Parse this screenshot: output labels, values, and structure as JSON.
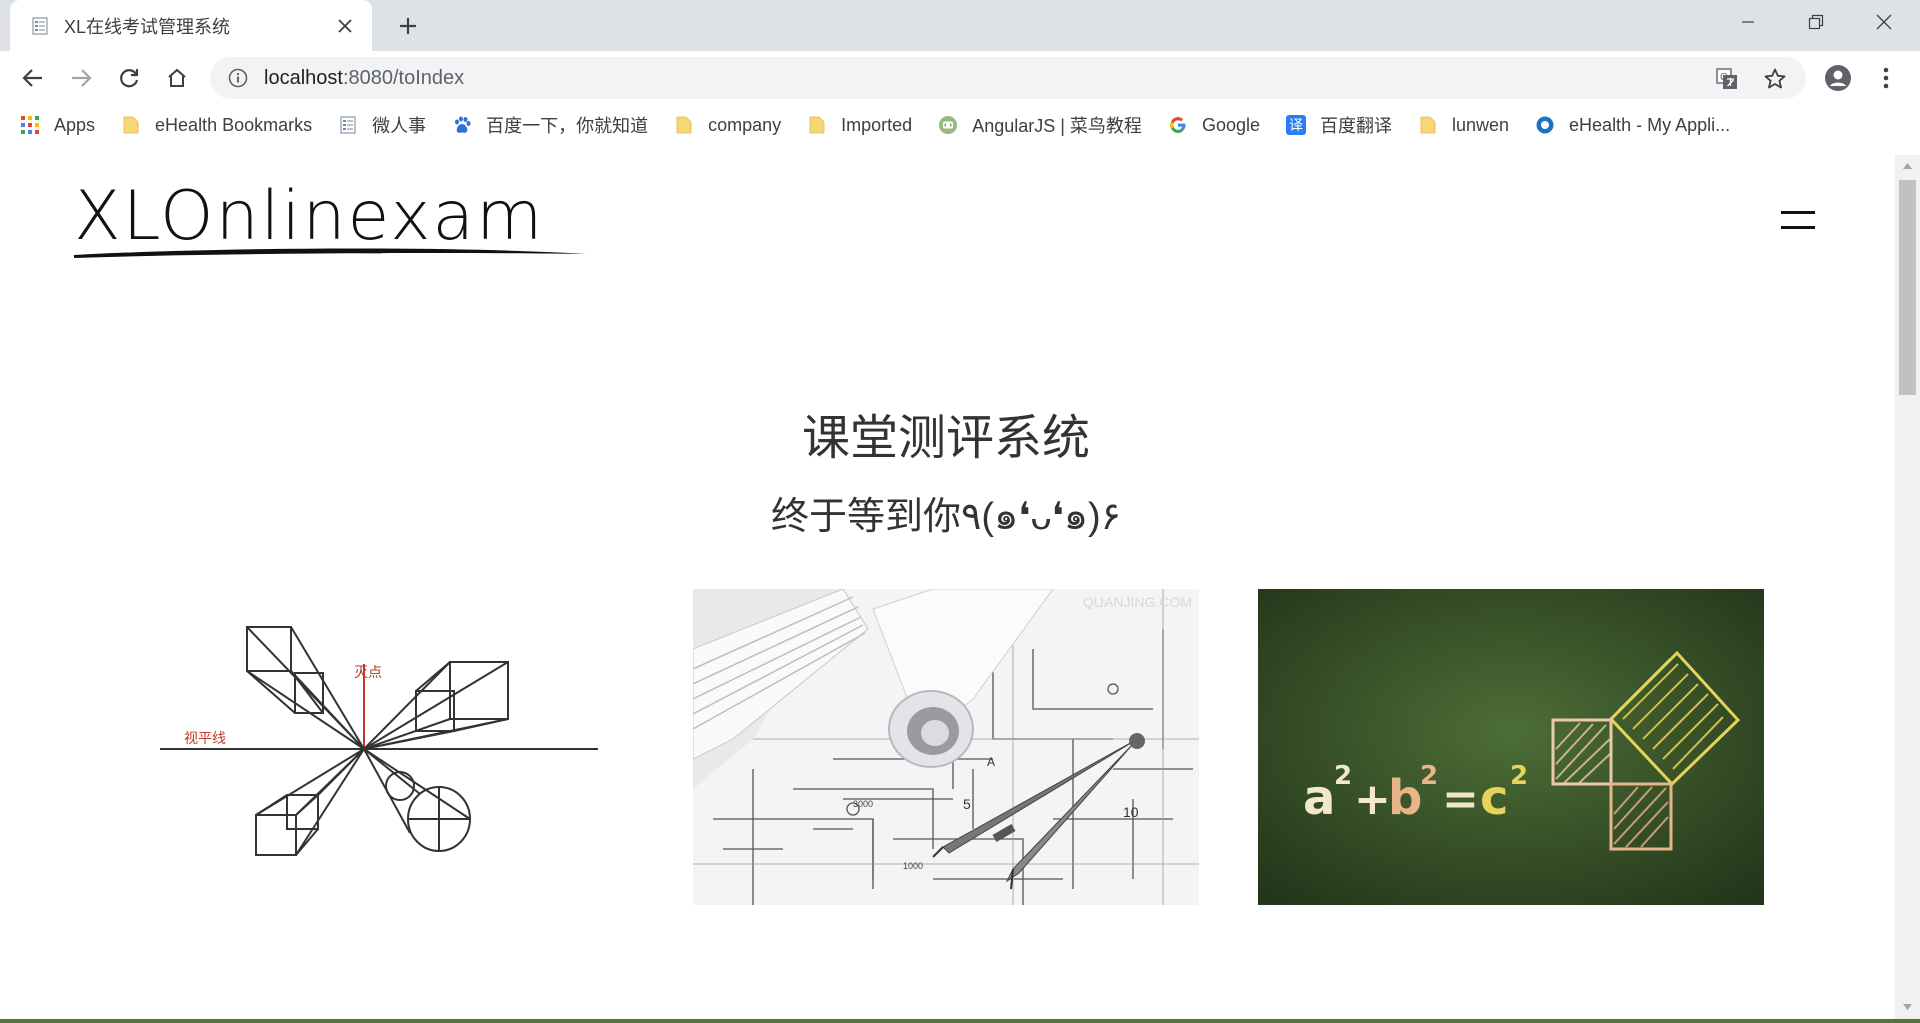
{
  "browser": {
    "tab_title": "XL在线考试管理系统",
    "url_host": "localhost",
    "url_rest": ":8080/toIndex",
    "bookmarks": [
      {
        "label": "Apps",
        "icon": "apps-grid-icon"
      },
      {
        "label": "eHealth Bookmarks",
        "icon": "folder-icon"
      },
      {
        "label": "微人事",
        "icon": "page-icon"
      },
      {
        "label": "百度一下，你就知道",
        "icon": "baidu-paw-icon"
      },
      {
        "label": "company",
        "icon": "folder-icon"
      },
      {
        "label": "Imported",
        "icon": "folder-icon"
      },
      {
        "label": "AngularJS | 菜鸟教程",
        "icon": "runoob-icon"
      },
      {
        "label": "Google",
        "icon": "google-g-icon"
      },
      {
        "label": "百度翻译",
        "icon": "baidu-translate-icon"
      },
      {
        "label": "lunwen",
        "icon": "folder-icon"
      },
      {
        "label": "eHealth - My Appli...",
        "icon": "ehealth-ring-icon"
      }
    ],
    "translate_badge": "G",
    "baidu_translate_glyph": "译"
  },
  "page": {
    "logo_text": "XLOnlinexam",
    "title": "课堂测评系统",
    "subtitle": "终于等到你٩(๑❛ᴗ❛๑)۶",
    "cards": [
      {
        "name": "perspective-drawing",
        "labels": [
          "灭点",
          "视平线"
        ]
      },
      {
        "name": "blueprint-compass",
        "labels": [
          "QUANJING.COM",
          "A",
          "5",
          "10",
          "1000",
          "3000"
        ]
      },
      {
        "name": "pythagorean-chalkboard",
        "formula": [
          "a",
          "2",
          "+",
          "b",
          "2",
          "=",
          "c",
          "2"
        ]
      }
    ]
  },
  "colors": {
    "chrome_bg": "#dee1e6",
    "omnibox_bg": "#f1f3f4",
    "chalkboard": "#3d5a2c",
    "chalk_yellow": "#e6d35a",
    "chalk_peach": "#e8b48a",
    "perspective_red": "#c0392b"
  }
}
